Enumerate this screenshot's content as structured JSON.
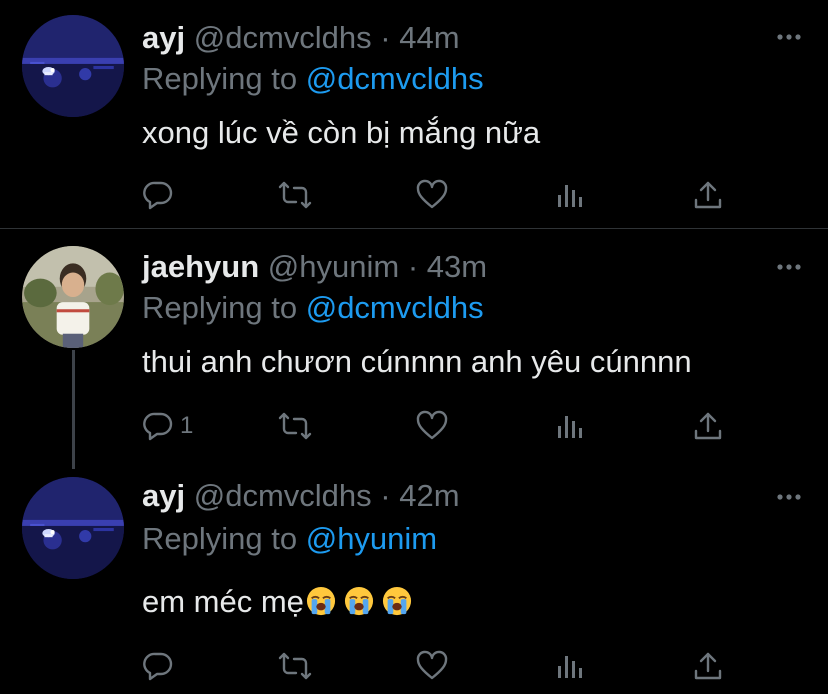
{
  "tweets": [
    {
      "name": "ayj",
      "handle": "@dcmvcldhs",
      "separator": "·",
      "time": "44m",
      "replying_prefix": "Replying to",
      "replying_to": "@dcmvcldhs",
      "text": "xong lúc về còn bị mắng nữa",
      "reply_count": "",
      "avatar": "night-fireworks-avatar"
    },
    {
      "name": "jaehyun",
      "handle": "@hyunim",
      "separator": "·",
      "time": "43m",
      "replying_prefix": "Replying to",
      "replying_to": "@dcmvcldhs",
      "text": "thui anh chươn cúnnnn anh yêu cúnnnn",
      "reply_count": "1",
      "avatar": "child-photo-avatar"
    },
    {
      "name": "ayj",
      "handle": "@dcmvcldhs",
      "separator": "·",
      "time": "42m",
      "replying_prefix": "Replying to",
      "replying_to": "@hyunim",
      "text": "em méc mẹ",
      "reply_count": "",
      "avatar": "night-fireworks-avatar",
      "emojis": [
        "loudly-crying-face-emoji",
        "loudly-crying-face-emoji",
        "loudly-crying-face-emoji"
      ]
    }
  ],
  "icons": {
    "reply": "reply-icon",
    "retweet": "retweet-icon",
    "like": "like-icon",
    "analytics": "analytics-icon",
    "share": "share-icon",
    "more": "more-icon"
  },
  "colors": {
    "background": "#000000",
    "text": "#e7e9ea",
    "muted": "#6e767d",
    "accent": "#1d9bf0",
    "divider": "#2f3336",
    "thread_line": "#3d4249"
  }
}
